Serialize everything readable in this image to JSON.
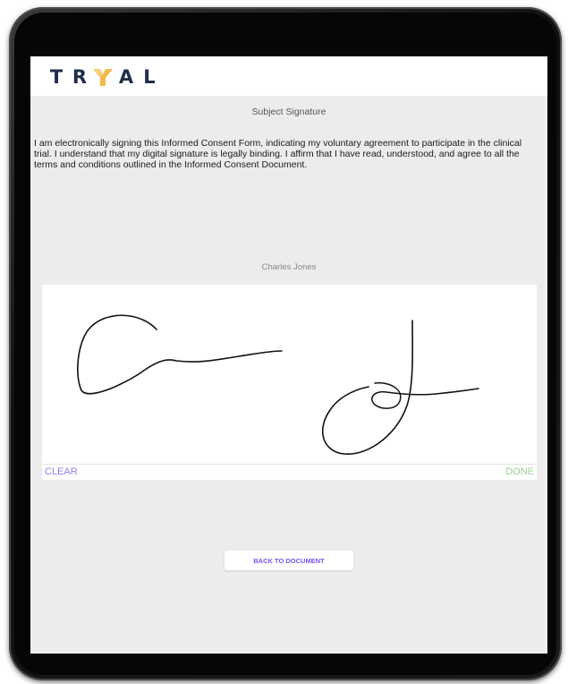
{
  "brand": {
    "logo_letters": [
      "T",
      "R",
      "A",
      "L"
    ],
    "logo_colors": {
      "text": "#1f2f4a",
      "mark": "#f2b94a"
    }
  },
  "signature_page": {
    "title": "Subject Signature",
    "consent_text": "I am electronically signing this Informed Consent Form, indicating my voluntary agreement to participate in the clinical trial. I understand that my digital signature is legally binding. I affirm that I have read, understood, and agree to all the terms and conditions outlined in the Informed Consent Document.",
    "signer_name": "Charles Jones",
    "clear_label": "CLEAR",
    "done_label": "DONE",
    "back_label": "BACK TO DOCUMENT"
  },
  "colors": {
    "accent": "#7a55e8",
    "clear": "#8b82e8",
    "done": "#9fcf97",
    "background": "#ececec"
  }
}
